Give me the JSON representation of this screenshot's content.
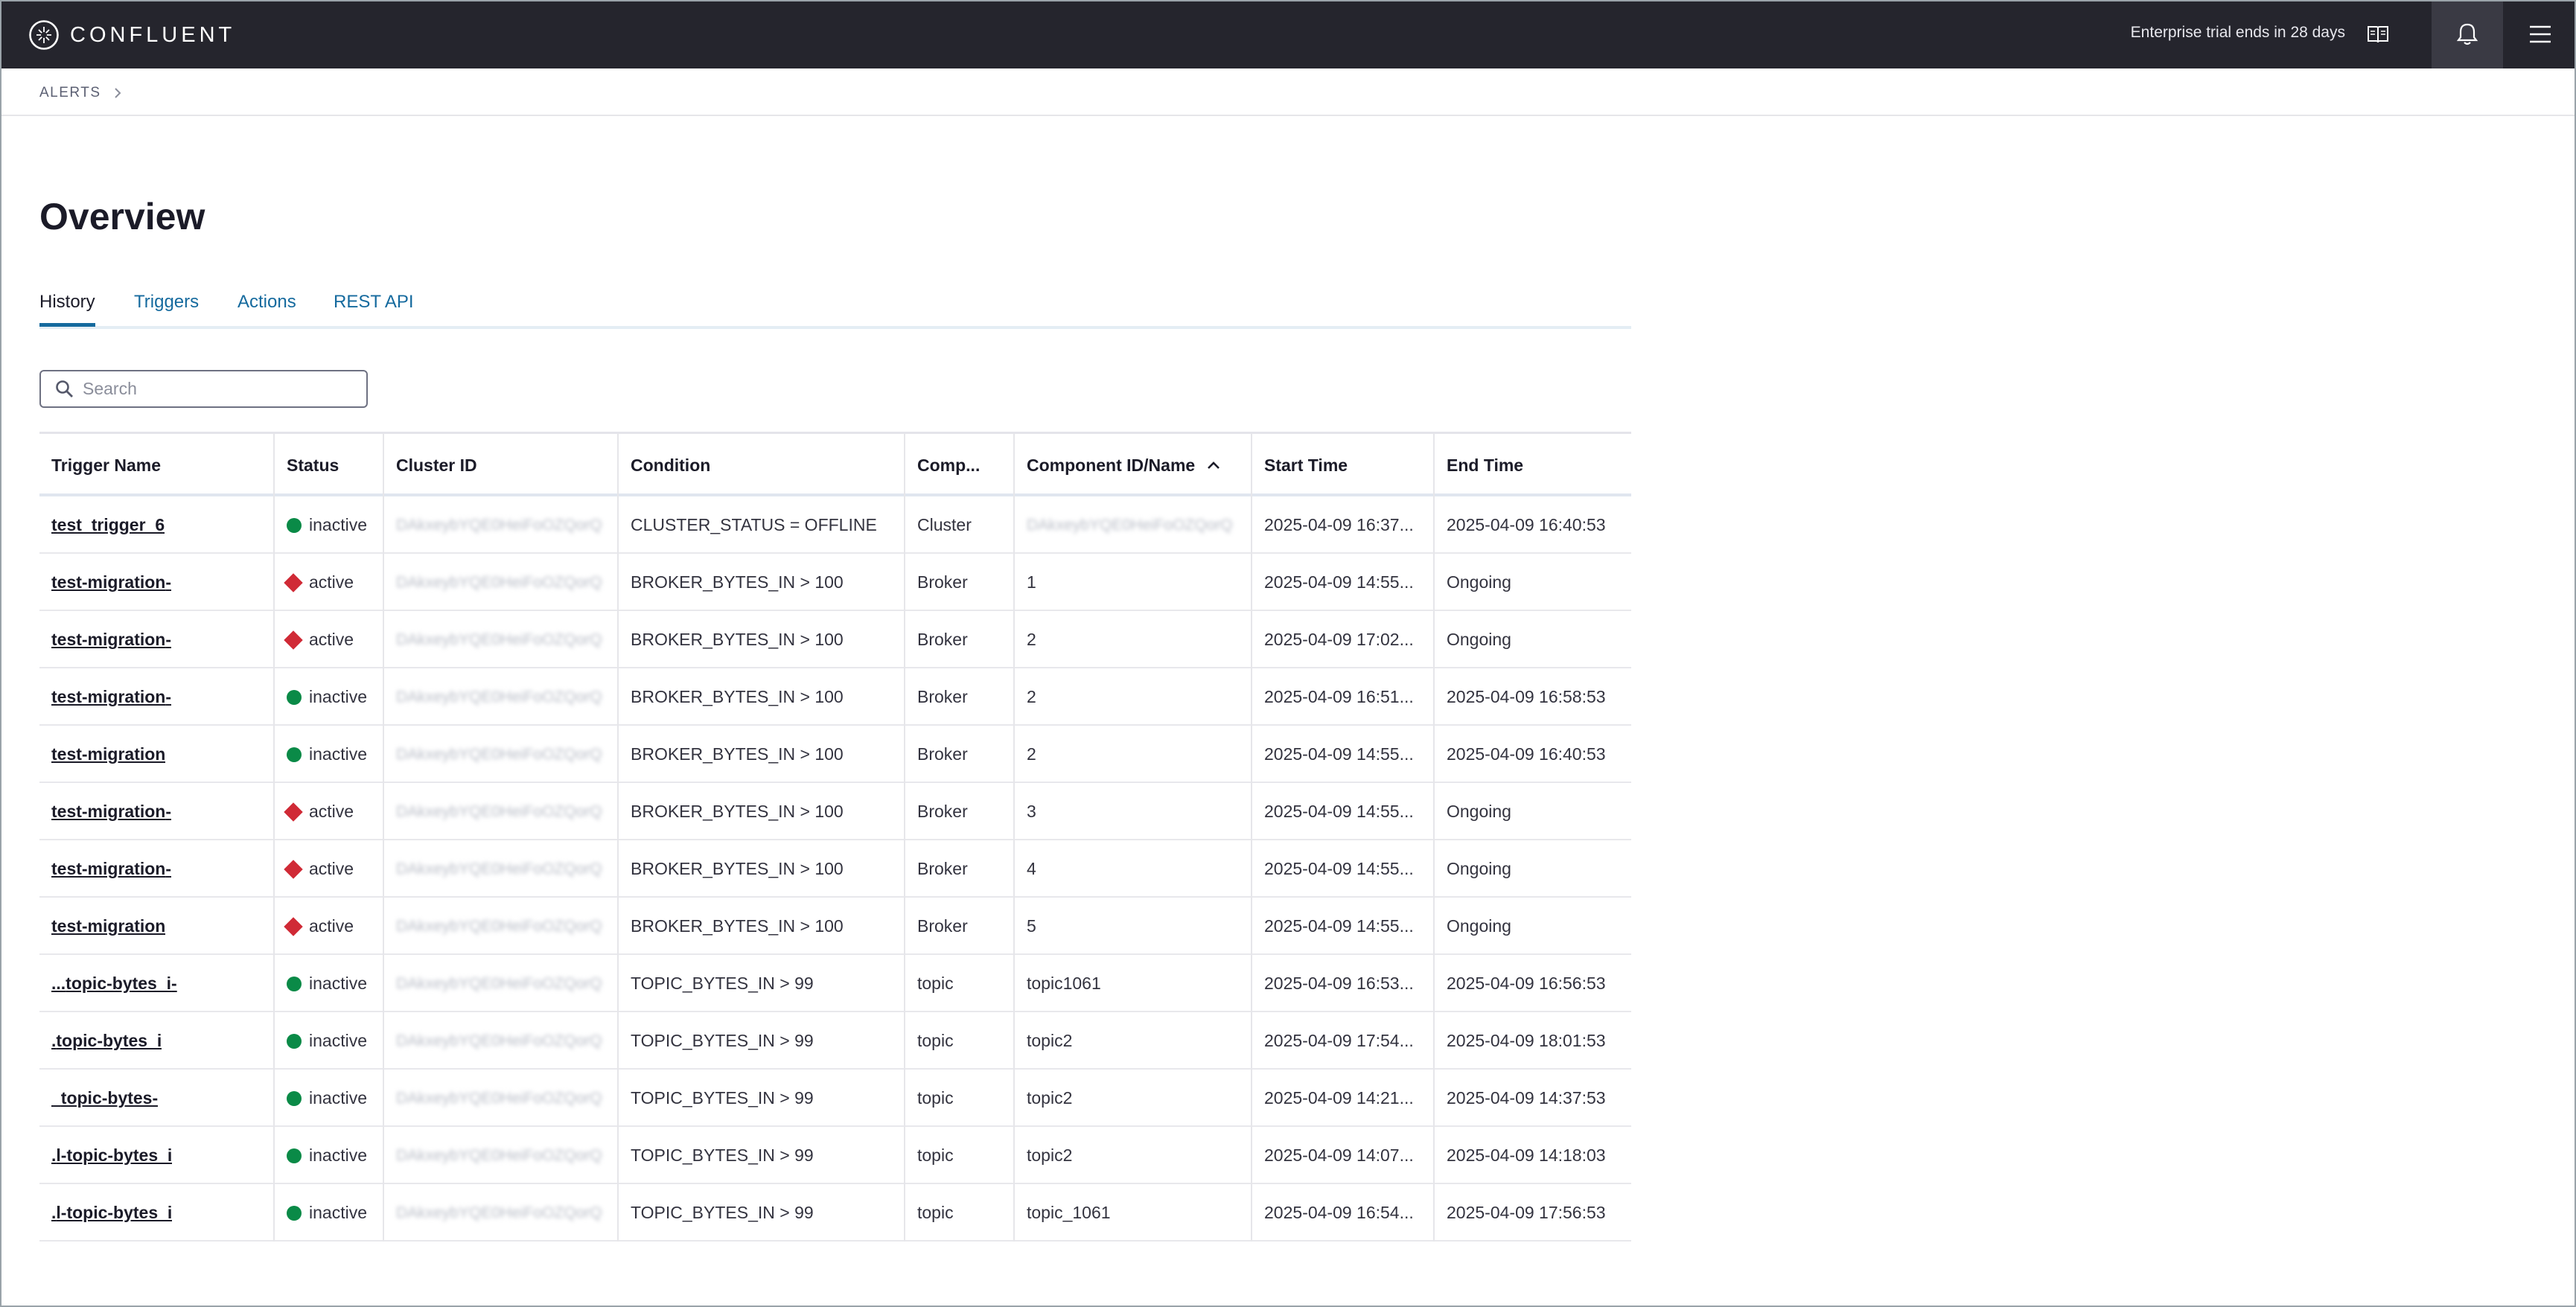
{
  "brand": {
    "name": "CONFLUENT"
  },
  "topbar": {
    "trial_text": "Enterprise trial ends in 28 days",
    "icons": [
      "docs-icon",
      "bell-icon",
      "menu-icon"
    ]
  },
  "breadcrumb": {
    "label": "ALERTS"
  },
  "page": {
    "title": "Overview"
  },
  "tabs": [
    {
      "label": "History",
      "active": true
    },
    {
      "label": "Triggers",
      "active": false
    },
    {
      "label": "Actions",
      "active": false
    },
    {
      "label": "REST API",
      "active": false
    }
  ],
  "search": {
    "placeholder": "Search",
    "value": ""
  },
  "table": {
    "columns": [
      "Trigger Name",
      "Status",
      "Cluster ID",
      "Condition",
      "Comp...",
      "Component ID/Name",
      "Start Time",
      "End Time"
    ],
    "sort": {
      "column": "Component ID/Name",
      "direction": "ascending"
    },
    "rows": [
      {
        "name": "test_trigger_6",
        "status": "inactive",
        "cluster": "DAkxeybYQE0HeiFoOZQorQ",
        "condition": "CLUSTER_STATUS = OFFLINE",
        "comp": "Cluster",
        "component": "DAkxeybYQE0HeiFoOZQorQ",
        "component_blurred": true,
        "start": "2025-04-09 16:37...",
        "end": "2025-04-09 16:40:53"
      },
      {
        "name": "-test-migration",
        "status": "active",
        "cluster": "DAkxeybYQE0HeiFoOZQorQ",
        "condition": "BROKER_BYTES_IN > 100",
        "comp": "Broker",
        "component": "1",
        "component_blurred": false,
        "start": "2025-04-09 14:55...",
        "end": "Ongoing"
      },
      {
        "name": "-test-migration",
        "status": "active",
        "cluster": "DAkxeybYQE0HeiFoOZQorQ",
        "condition": "BROKER_BYTES_IN > 100",
        "comp": "Broker",
        "component": "2",
        "component_blurred": false,
        "start": "2025-04-09 17:02...",
        "end": "Ongoing"
      },
      {
        "name": "-test-migration",
        "status": "inactive",
        "cluster": "DAkxeybYQE0HeiFoOZQorQ",
        "condition": "BROKER_BYTES_IN > 100",
        "comp": "Broker",
        "component": "2",
        "component_blurred": false,
        "start": "2025-04-09 16:51...",
        "end": "2025-04-09 16:58:53"
      },
      {
        "name": "test-migration",
        "status": "inactive",
        "cluster": "DAkxeybYQE0HeiFoOZQorQ",
        "condition": "BROKER_BYTES_IN > 100",
        "comp": "Broker",
        "component": "2",
        "component_blurred": false,
        "start": "2025-04-09 14:55...",
        "end": "2025-04-09 16:40:53"
      },
      {
        "name": "-test-migration",
        "status": "active",
        "cluster": "DAkxeybYQE0HeiFoOZQorQ",
        "condition": "BROKER_BYTES_IN > 100",
        "comp": "Broker",
        "component": "3",
        "component_blurred": false,
        "start": "2025-04-09 14:55...",
        "end": "Ongoing"
      },
      {
        "name": "-test-migration",
        "status": "active",
        "cluster": "DAkxeybYQE0HeiFoOZQorQ",
        "condition": "BROKER_BYTES_IN > 100",
        "comp": "Broker",
        "component": "4",
        "component_blurred": false,
        "start": "2025-04-09 14:55...",
        "end": "Ongoing"
      },
      {
        "name": "test-migration",
        "status": "active",
        "cluster": "DAkxeybYQE0HeiFoOZQorQ",
        "condition": "BROKER_BYTES_IN > 100",
        "comp": "Broker",
        "component": "5",
        "component_blurred": false,
        "start": "2025-04-09 14:55...",
        "end": "Ongoing"
      },
      {
        "name": "-topic-bytes_i...",
        "status": "inactive",
        "cluster": "DAkxeybYQE0HeiFoOZQorQ",
        "condition": "TOPIC_BYTES_IN > 99",
        "comp": "topic",
        "component": "topic1061",
        "component_blurred": false,
        "start": "2025-04-09 16:53...",
        "end": "2025-04-09 16:56:53"
      },
      {
        "name": "topic-bytes_i.",
        "status": "inactive",
        "cluster": "DAkxeybYQE0HeiFoOZQorQ",
        "condition": "TOPIC_BYTES_IN > 99",
        "comp": "topic",
        "component": "topic2",
        "component_blurred": false,
        "start": "2025-04-09 17:54...",
        "end": "2025-04-09 18:01:53"
      },
      {
        "name": "-topic-bytes_",
        "status": "inactive",
        "cluster": "DAkxeybYQE0HeiFoOZQorQ",
        "condition": "TOPIC_BYTES_IN > 99",
        "comp": "topic",
        "component": "topic2",
        "component_blurred": false,
        "start": "2025-04-09 14:21...",
        "end": "2025-04-09 14:37:53"
      },
      {
        "name": "l-topic-bytes_i.",
        "status": "inactive",
        "cluster": "DAkxeybYQE0HeiFoOZQorQ",
        "condition": "TOPIC_BYTES_IN > 99",
        "comp": "topic",
        "component": "topic2",
        "component_blurred": false,
        "start": "2025-04-09 14:07...",
        "end": "2025-04-09 14:18:03"
      },
      {
        "name": "l-topic-bytes_i.",
        "status": "inactive",
        "cluster": "DAkxeybYQE0HeiFoOZQorQ",
        "condition": "TOPIC_BYTES_IN > 99",
        "comp": "topic",
        "component": "topic_1061",
        "component_blurred": false,
        "start": "2025-04-09 16:54...",
        "end": "2025-04-09 17:56:53"
      }
    ]
  },
  "colors": {
    "topbar": "#25252d",
    "link": "#156a9e",
    "active_status": "#d02a36",
    "inactive_status": "#0a8a47"
  }
}
